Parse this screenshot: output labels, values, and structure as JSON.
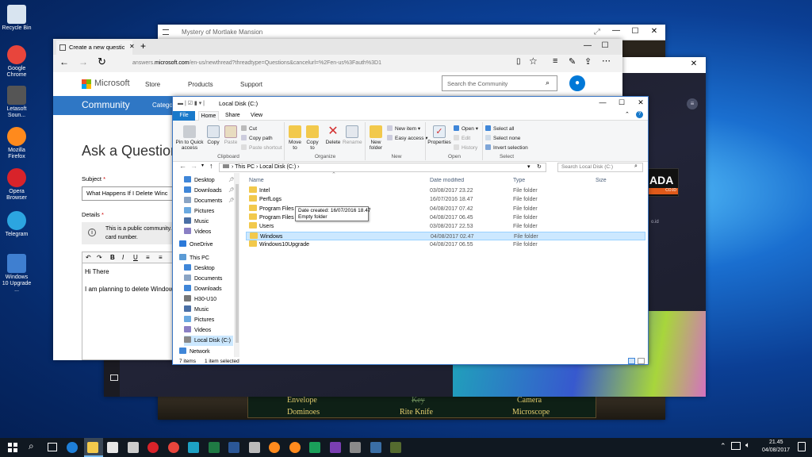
{
  "desktop": {
    "icons": [
      {
        "label": "Recycle Bin",
        "color": "#d8e4f0"
      },
      {
        "label": "Google Chrome",
        "color": "#e8453c"
      },
      {
        "label": "Letasoft Soun...",
        "color": "#555555"
      },
      {
        "label": "Mozilla Firefox",
        "color": "#ff8a1d"
      },
      {
        "label": "Opera Browser",
        "color": "#d8232a"
      },
      {
        "label": "Telegram",
        "color": "#2ca5e0"
      },
      {
        "label": "Windows 10 Upgrade ...",
        "color": "#3f7fd0"
      }
    ]
  },
  "game_window": {
    "title": "Mystery of Mortlake Mansion",
    "items": [
      "Envelope",
      "Key",
      "Camera",
      "Dominoes",
      "Rite Knife",
      "Microscope"
    ]
  },
  "dark_window": {
    "brand": "ADA",
    "brand_sub": "CO.ID",
    "domain_fragment": "o.id"
  },
  "browser": {
    "tab_title": "Create a new question o",
    "url_prefix": "answers.",
    "url_domain": "microsoft.com",
    "url_rest": "/en-us/newthread?threadtype=Questions&cancelurl=%2Fen-us%3Fauth%3D1",
    "nav": {
      "brand": "Microsoft",
      "store": "Store",
      "products": "Products",
      "support": "Support"
    },
    "search_placeholder": "Search the Community",
    "community": "Community",
    "category_fragment": "Catego",
    "page_heading": "Ask a Question",
    "subject_label": "Subject",
    "subject_value": "What Happens If I Delete Winc",
    "details_label": "Details",
    "notice_line1": "This is a public community.",
    "notice_line2": "card number.",
    "editor_line1": "Hi There",
    "editor_line2": "I am planning to delete Window"
  },
  "explorer": {
    "title": "Local Disk (C:)",
    "ribbon_tabs": [
      "File",
      "Home",
      "Share",
      "View"
    ],
    "clipboard": {
      "pin": "Pin to Quick access",
      "copy": "Copy",
      "paste": "Paste",
      "cut": "Cut",
      "copy_path": "Copy path",
      "paste_shortcut": "Paste shortcut",
      "group": "Clipboard"
    },
    "organize": {
      "move": "Move to",
      "copy": "Copy to",
      "delete": "Delete",
      "rename": "Rename",
      "group": "Organize"
    },
    "new": {
      "folder": "New folder",
      "new_item": "New item",
      "easy_access": "Easy access",
      "group": "New"
    },
    "open": {
      "properties": "Properties",
      "open": "Open",
      "edit": "Edit",
      "history": "History",
      "group": "Open"
    },
    "select": {
      "all": "Select all",
      "none": "Select none",
      "invert": "Invert selection",
      "group": "Select"
    },
    "breadcrumb": [
      "This PC",
      "Local Disk (C:)"
    ],
    "search_placeholder": "Search Local Disk (C:)",
    "columns": [
      "Name",
      "Date modified",
      "Type",
      "Size"
    ],
    "files": [
      {
        "name": "Intel",
        "date": "03/08/2017 23.22",
        "type": "File folder"
      },
      {
        "name": "PerfLogs",
        "date": "16/07/2016 18.47",
        "type": "File folder"
      },
      {
        "name": "Program Files",
        "date": "04/08/2017 07.42",
        "type": "File folder"
      },
      {
        "name": "Program Files (x8",
        "date": "04/08/2017 06.45",
        "type": "File folder"
      },
      {
        "name": "Users",
        "date": "03/08/2017 22.53",
        "type": "File folder"
      },
      {
        "name": "Windows",
        "date": "04/08/2017 02.47",
        "type": "File folder"
      },
      {
        "name": "Windows10Upgrade",
        "date": "04/08/2017 06.55",
        "type": "File folder"
      }
    ],
    "tooltip": {
      "line1": "Date created: 16/07/2016 18.47",
      "line2": "Empty folder"
    },
    "nav_pane": [
      {
        "label": "Desktop",
        "color": "#3f86d8"
      },
      {
        "label": "Downloads",
        "color": "#3f86d8"
      },
      {
        "label": "Documents",
        "color": "#8aa4c4"
      },
      {
        "label": "Pictures",
        "color": "#6aa9e0"
      },
      {
        "label": "Music",
        "color": "#4a6fa5"
      },
      {
        "label": "Videos",
        "color": "#8a7fc4"
      },
      {
        "label": "OneDrive",
        "color": "#2b79d9"
      },
      {
        "label": "This PC",
        "color": "#5b9bd5"
      },
      {
        "label": "Desktop",
        "color": "#3f86d8"
      },
      {
        "label": "Documents",
        "color": "#8aa4c4"
      },
      {
        "label": "Downloads",
        "color": "#3f86d8"
      },
      {
        "label": "H30-U10",
        "color": "#777777"
      },
      {
        "label": "Music",
        "color": "#4a6fa5"
      },
      {
        "label": "Pictures",
        "color": "#6aa9e0"
      },
      {
        "label": "Videos",
        "color": "#8a7fc4"
      },
      {
        "label": "Local Disk (C:)",
        "color": "#888888"
      },
      {
        "label": "Network",
        "color": "#3f86d8"
      }
    ],
    "status_items": "7 items",
    "status_selected": "1 item selected"
  },
  "taskbar": {
    "time": "21.45",
    "date": "04/08/2017",
    "apps": [
      {
        "name": "edge",
        "color": "#1e7fd8"
      },
      {
        "name": "file-explorer",
        "color": "#f2c94c"
      },
      {
        "name": "store",
        "color": "#e6e6e6"
      },
      {
        "name": "app-grid",
        "color": "#cccccc"
      },
      {
        "name": "opera",
        "color": "#d8232a"
      },
      {
        "name": "chrome",
        "color": "#e8453c"
      },
      {
        "name": "maps",
        "color": "#1da1c4"
      },
      {
        "name": "excel",
        "color": "#1f7a44"
      },
      {
        "name": "word",
        "color": "#2b5797"
      },
      {
        "name": "settings",
        "color": "#bbbbbb"
      },
      {
        "name": "firefox",
        "color": "#ff8a1d"
      },
      {
        "name": "firefox-2",
        "color": "#ff8a1d"
      },
      {
        "name": "app-green",
        "color": "#1aa05a"
      },
      {
        "name": "app-purple",
        "color": "#7a3fb2"
      },
      {
        "name": "app-gray",
        "color": "#8a8a8a"
      },
      {
        "name": "app-photo",
        "color": "#3a6ea5"
      },
      {
        "name": "app-dark",
        "color": "#556b2f"
      }
    ]
  }
}
